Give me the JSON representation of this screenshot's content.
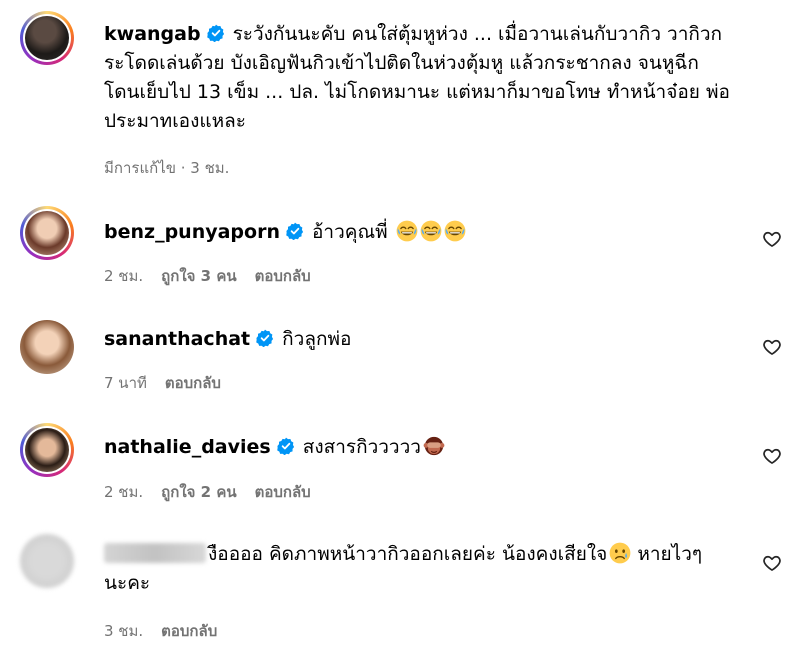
{
  "comments": [
    {
      "username": "kwangab",
      "verified": true,
      "text": "ระวังกันนะคับ คนใส่ตุ้มหูห่วง ... เมื่อวานเล่นกับวากิว วากิวกระโดดเล่นด้วย บังเอิญฟันกิวเข้าไปติดในห่วงตุ้มหู แล้วกระชากลง จนหูฉีก โดนเย็บไป 13 เข็ม ... ปล. ไม่โกดหมานะ แต่หมาก็มาขอโทษ ทำหน้าจ๋อย พ่อประมาทเองแหละ",
      "meta": "มีการแก้ไข · 3 ชม."
    },
    {
      "username": "benz_punyaporn",
      "verified": true,
      "text": "อ้าวคุณพี่",
      "emojis": [
        "face-with-tears-of-joy",
        "face-with-tears-of-joy",
        "face-with-tears-of-joy"
      ],
      "time": "2 ชม.",
      "likes": "ถูกใจ 3 คน",
      "reply": "ตอบกลับ"
    },
    {
      "username": "sananthachat",
      "verified": true,
      "text": "กิวลูกพ่อ",
      "time": "7 นาที",
      "reply": "ตอบกลับ"
    },
    {
      "username": "nathalie_davies",
      "verified": true,
      "text": "สงสารกิววววว",
      "emojis": [
        "see-no-evil-monkey"
      ],
      "time": "2 ชม.",
      "likes": "ถูกใจ 2 คน",
      "reply": "ตอบกลับ"
    },
    {
      "username": "",
      "verified": false,
      "text": "งืออออ คิดภาพหน้าวากิวออกเลยค่ะ น้องคงเสียใจ",
      "text_after": " หายไวๆนะคะ",
      "emojis": [
        "sad-but-relieved-face"
      ],
      "time": "3 ชม.",
      "reply": "ตอบกลับ"
    }
  ],
  "colors": {
    "verified": "#0095f6",
    "meta": "#737373"
  }
}
